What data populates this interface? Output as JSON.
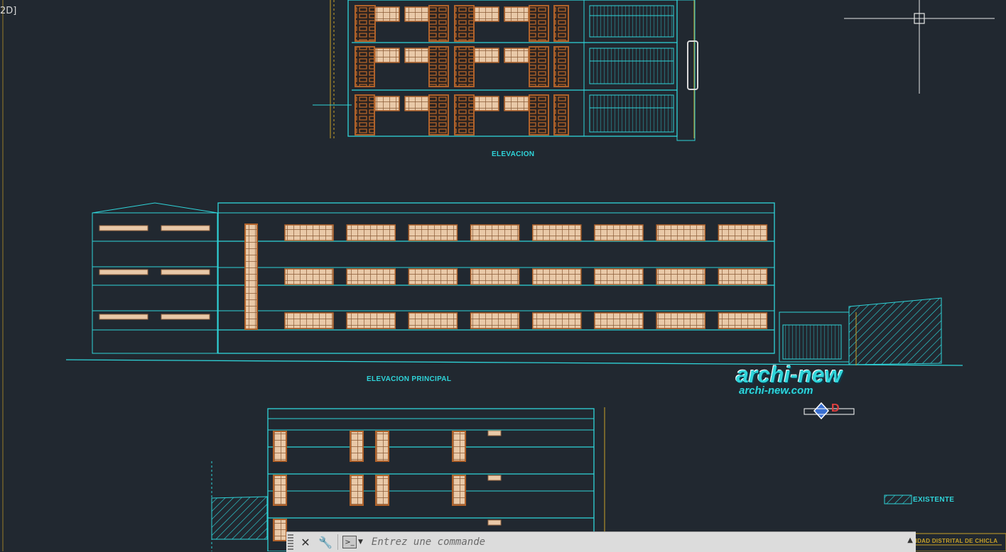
{
  "viewport": {
    "view_label": "2D]"
  },
  "labels": {
    "elevation_top": "ELEVACION",
    "elevation_main": "ELEVACION PRINCIPAL",
    "legend_existing": "EXISTENTE",
    "title_block": "MUNICIPALIDAD DISTRITAL DE CHICLA"
  },
  "watermark": {
    "brand": "archi-new",
    "url": "archi-new.com"
  },
  "command_line": {
    "placeholder": "Entrez une commande"
  },
  "colors": {
    "background": "#212830",
    "cyan": "#2fd4d9",
    "window_frame": "#b0622a",
    "glass": "#e9c9a8",
    "dimension": "#c9a227"
  },
  "icons": [
    "crosshair-cursor",
    "close-icon",
    "wrench-icon",
    "command-prompt-icon",
    "chevron-down-icon",
    "history-up-icon"
  ]
}
